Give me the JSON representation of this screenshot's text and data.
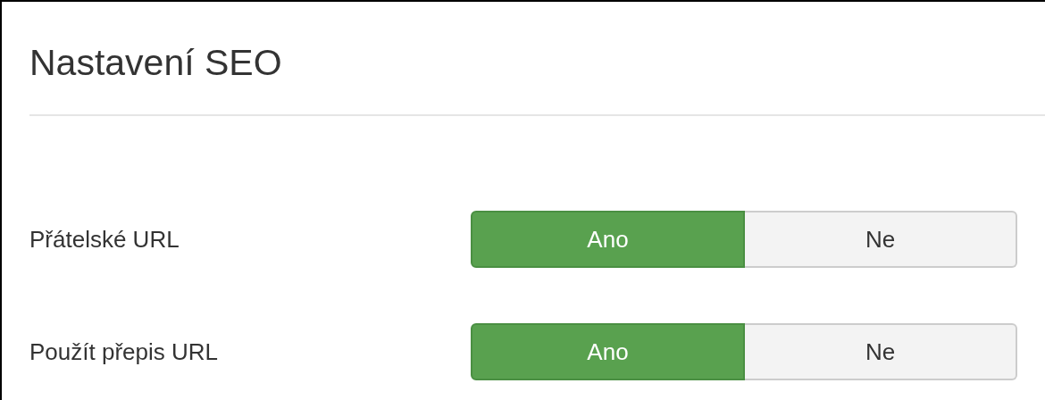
{
  "title": "Nastavení SEO",
  "fields": [
    {
      "label": "Přátelské URL",
      "options": [
        {
          "label": "Ano",
          "selected": true
        },
        {
          "label": "Ne",
          "selected": false
        }
      ]
    },
    {
      "label": "Použít přepis URL",
      "options": [
        {
          "label": "Ano",
          "selected": true
        },
        {
          "label": "Ne",
          "selected": false
        }
      ]
    }
  ]
}
